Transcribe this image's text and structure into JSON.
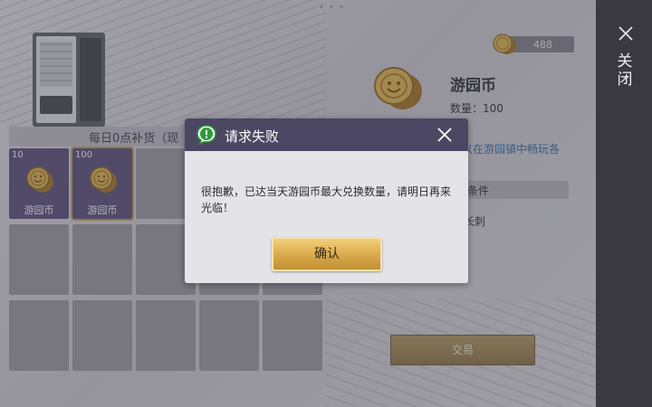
{
  "shop": {
    "title": "每日0点补货（现",
    "slots": [
      {
        "qty": "10",
        "name": "游园币",
        "selected": false
      },
      {
        "qty": "100",
        "name": "游园币",
        "selected": true
      }
    ]
  },
  "detail": {
    "balance": "488",
    "item_name": "游园币",
    "item_qty": "数量：100",
    "item_desc": "以在游园镇中畅玩各",
    "conditions_title": "条件",
    "condition_item": "长刺",
    "trade_label": "交易"
  },
  "sidebar": {
    "close_label": "关闭"
  },
  "dialog": {
    "title": "请求失败",
    "message": "很抱歉，已达当天游园币最大兑换数量，请明日再来光临！",
    "confirm_label": "确认"
  },
  "colors": {
    "dialog_header": "#4b4662",
    "confirm_gold": "#d8a84a",
    "sidebar": "#3a3942",
    "item_slot": "#5a4f7a"
  },
  "icons": {
    "coin": "gold-coin-icon",
    "alert": "speech-exclamation-icon",
    "close": "close-icon"
  }
}
